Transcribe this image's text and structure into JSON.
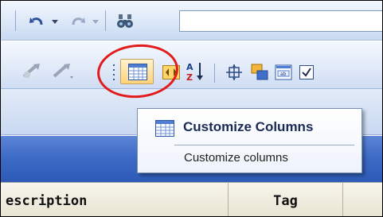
{
  "tooltip": {
    "title": "Customize Columns",
    "description": "Customize columns"
  },
  "table": {
    "columns": [
      "escription",
      "Tag"
    ]
  },
  "toolbar1": {
    "icons": [
      "undo-icon",
      "undo-dropdown-icon",
      "redo-icon",
      "redo-dropdown-icon",
      "find-binoculars-icon"
    ],
    "search_value": ""
  },
  "toolbar2": {
    "icons": [
      "outdent-icon",
      "indent-icon",
      "customize-columns-icon",
      "column-chooser-icon",
      "sort-az-icon",
      "auto-fit-icon",
      "layers-icon",
      "insert-field-icon",
      "checkbox-icon"
    ],
    "active": "customize-columns-icon"
  },
  "annotation": {
    "color": "#e21c1c",
    "shape": "circle"
  }
}
